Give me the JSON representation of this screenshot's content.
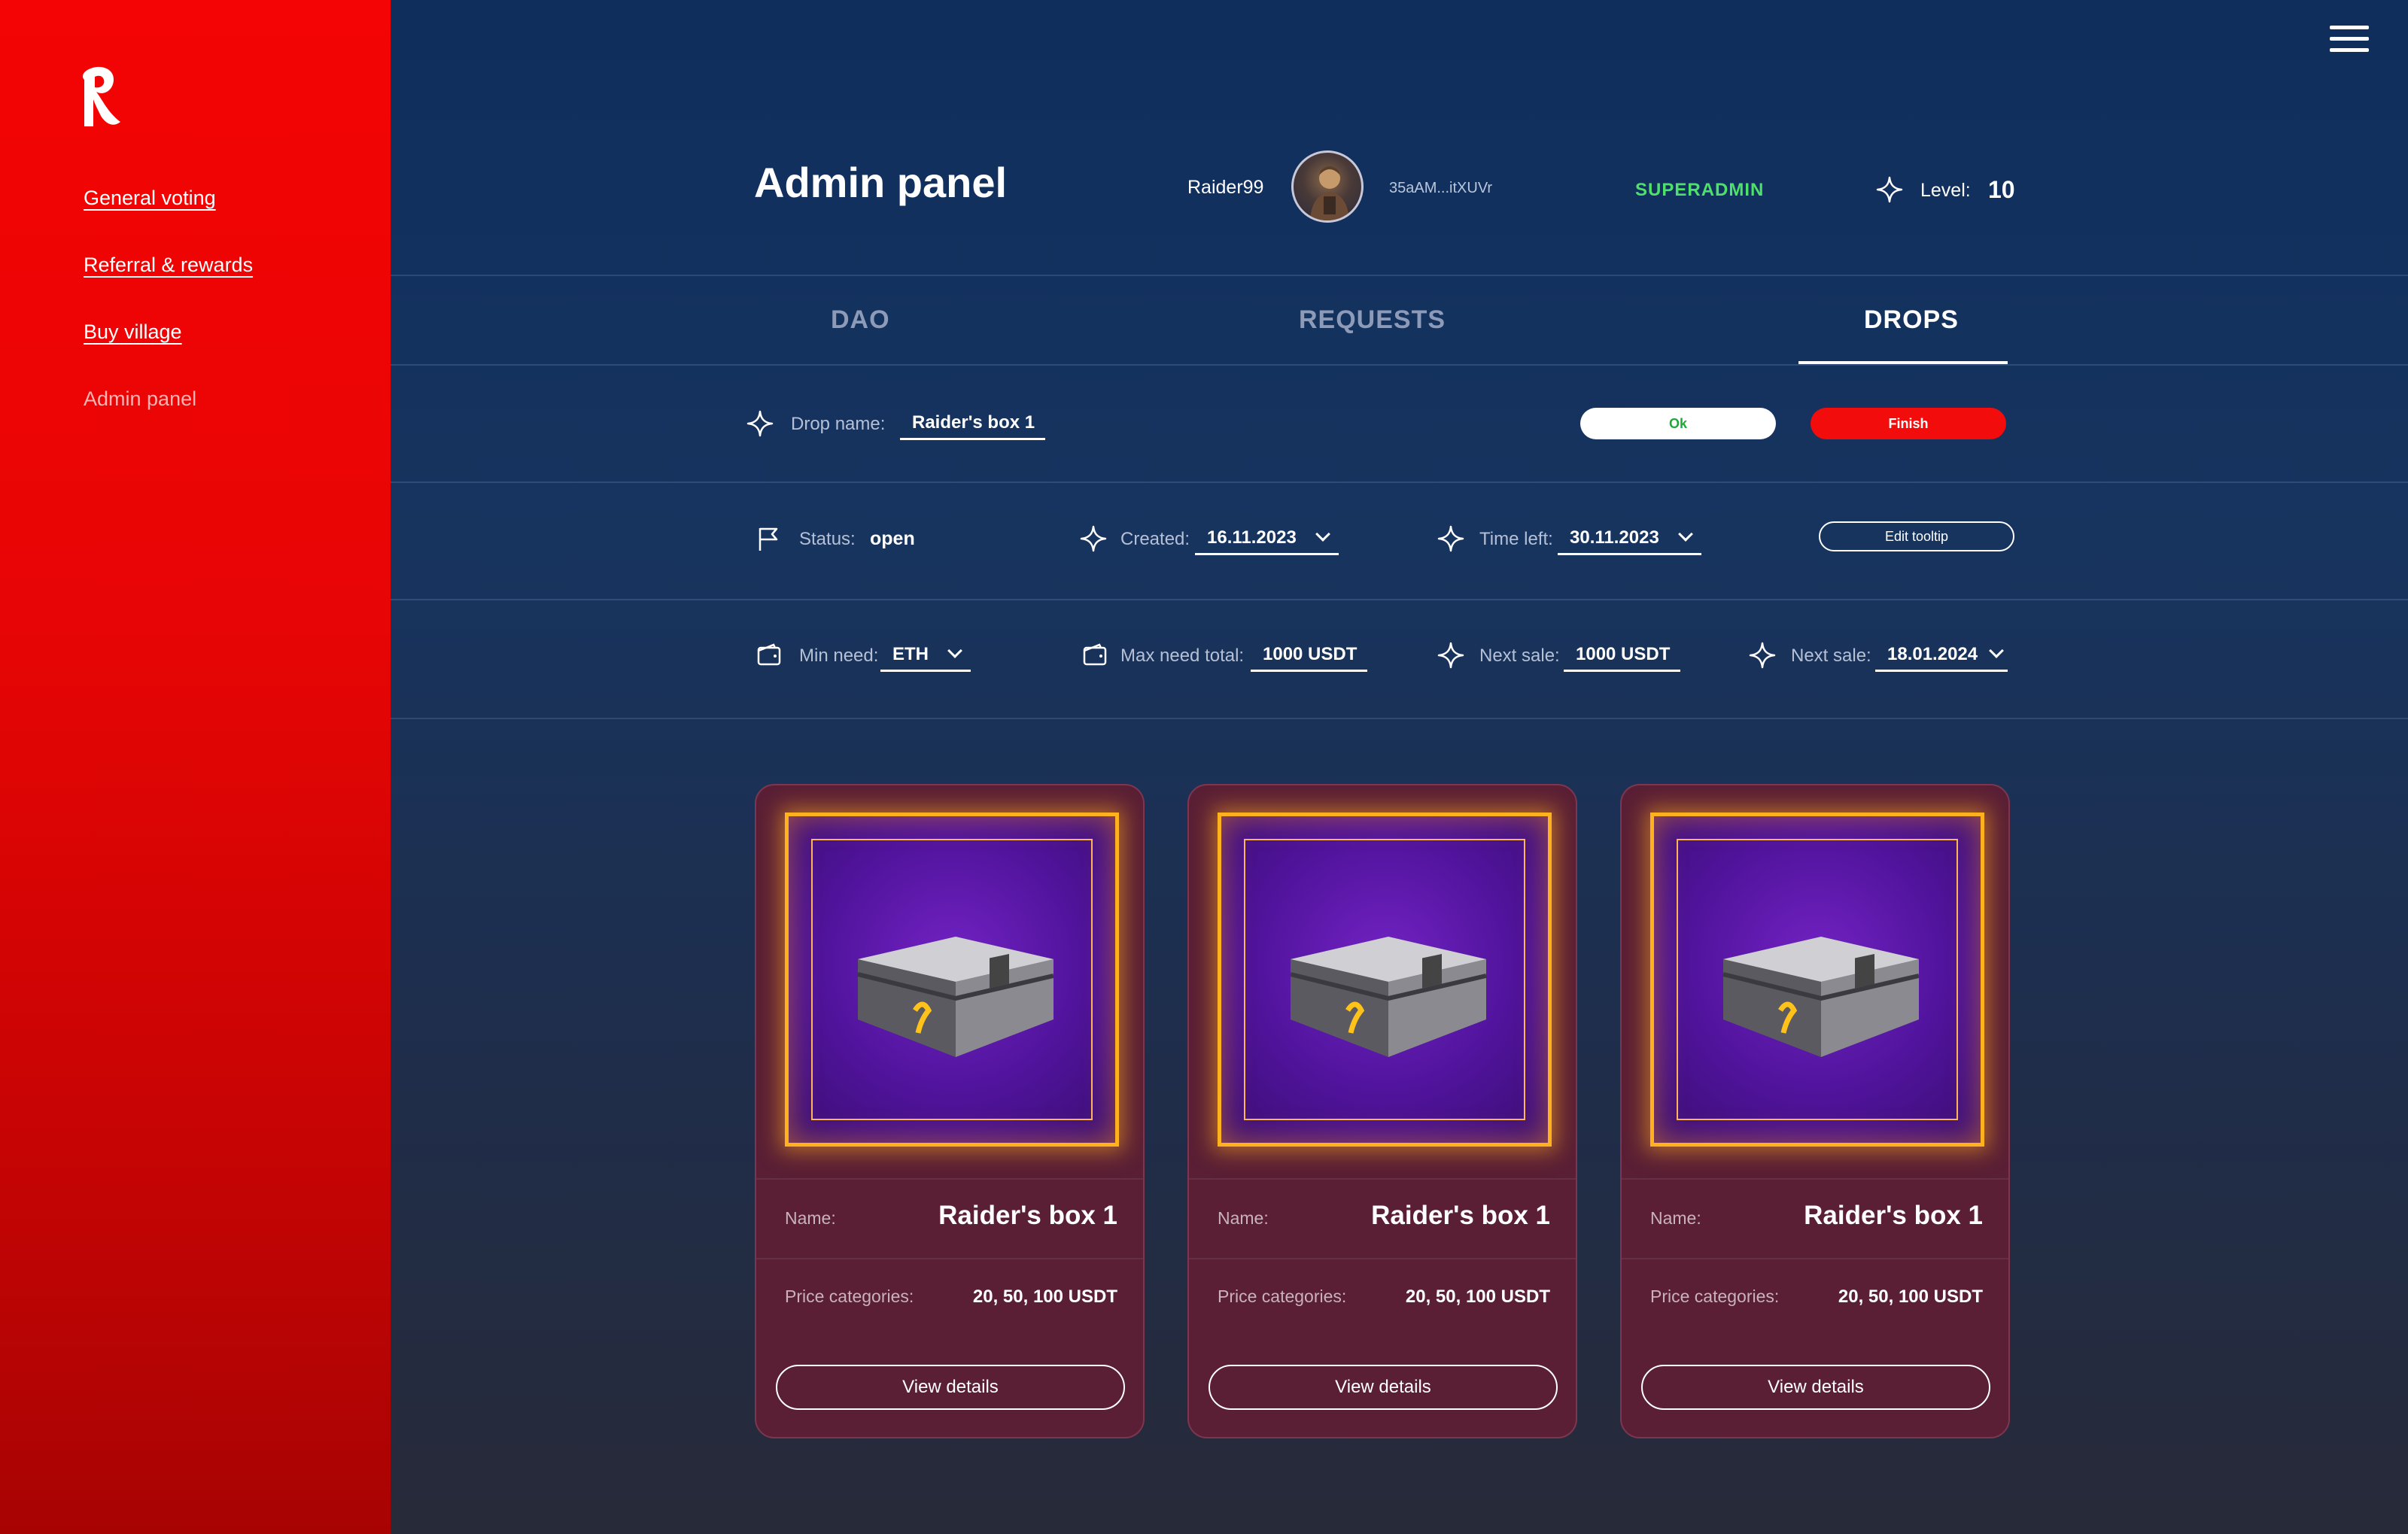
{
  "sidebar": {
    "items": [
      {
        "label": "General voting"
      },
      {
        "label": "Referral & rewards"
      },
      {
        "label": "Buy village"
      },
      {
        "label": "Admin panel"
      }
    ]
  },
  "header": {
    "title": "Admin panel",
    "username": "Raider99",
    "wallet": "35aAM...itXUVr",
    "role": "SUPERADMIN",
    "level_label": "Level:",
    "level_value": "10"
  },
  "tabs": [
    {
      "label": "DAO"
    },
    {
      "label": "REQUESTS"
    },
    {
      "label": "DROPS",
      "active": true
    }
  ],
  "drop": {
    "name_label": "Drop name:",
    "name_value": "Raider's box 1",
    "ok_label": "Ok",
    "finish_label": "Finish"
  },
  "meta": {
    "status_label": "Status:",
    "status_value": "open",
    "created_label": "Created:",
    "created_value": "16.11.2023",
    "time_left_label": "Time left:",
    "time_left_value": "30.11.2023",
    "edit_tooltip_label": "Edit tooltip"
  },
  "limits": {
    "min_need_label": "Min need:",
    "min_need_value": "ETH",
    "max_need_label": "Max need total:",
    "max_need_value": "1000 USDT",
    "next_sale_label": "Next sale:",
    "next_sale_value": "1000 USDT",
    "next_sale_date_label": "Next sale:",
    "next_sale_date_value": "18.01.2024"
  },
  "cards": [
    {
      "name_label": "Name:",
      "name": "Raider's box 1",
      "price_label": "Price categories:",
      "price": "20, 50, 100 USDT",
      "button": "View details"
    },
    {
      "name_label": "Name:",
      "name": "Raider's box 1",
      "price_label": "Price categories:",
      "price": "20, 50, 100 USDT",
      "button": "View details"
    },
    {
      "name_label": "Name:",
      "name": "Raider's box 1",
      "price_label": "Price categories:",
      "price": "20, 50, 100 USDT",
      "button": "View details"
    }
  ],
  "colors": {
    "sidebar": "#f40404",
    "role": "#4ee06a",
    "finish": "#f20c0c",
    "card": "#5a1f35",
    "frame": "#ffb21e"
  }
}
